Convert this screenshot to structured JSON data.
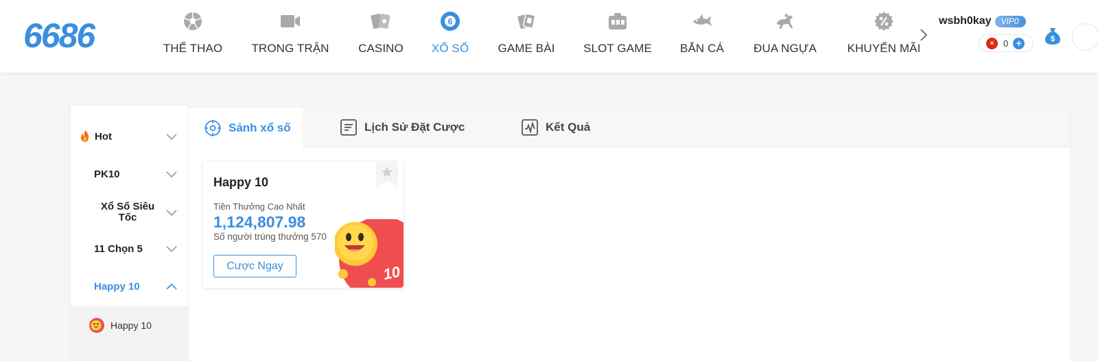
{
  "header": {
    "logo": "6686",
    "nav": [
      {
        "label": "THỂ THAO",
        "icon": "soccer-ball-icon"
      },
      {
        "label": "TRONG TRẬN",
        "icon": "video-camera-icon"
      },
      {
        "label": "CASINO",
        "icon": "playing-cards-icon"
      },
      {
        "label": "XỔ SỐ",
        "icon": "lottery-ball-icon",
        "active": true
      },
      {
        "label": "GAME BÀI",
        "icon": "card-game-icon"
      },
      {
        "label": "SLOT GAME",
        "icon": "slot-machine-icon"
      },
      {
        "label": "BẮN CÁ",
        "icon": "fish-icon"
      },
      {
        "label": "ĐUA NGỰA",
        "icon": "horse-racing-icon"
      },
      {
        "label": "KHUYẾN MÃI",
        "icon": "discount-icon"
      }
    ],
    "user": {
      "name": "wsbh0kay",
      "vip": "VIP0",
      "balance": "0",
      "currency_flag": "vietnam-flag-icon"
    }
  },
  "sidebar": {
    "items": [
      {
        "label": "Hot",
        "icon": "fire-icon"
      },
      {
        "label": "PK10"
      },
      {
        "label": "Xổ Số Siêu Tốc"
      },
      {
        "label": "11 Chọn 5"
      },
      {
        "label": "Happy 10",
        "active": true
      }
    ],
    "sub_items": [
      {
        "label": "Happy 10",
        "icon": "happy-10-icon"
      }
    ]
  },
  "tabs": [
    {
      "label": "Sảnh xổ số",
      "icon": "target-icon",
      "active": true
    },
    {
      "label": "Lịch Sử Đặt Cược",
      "icon": "document-icon"
    },
    {
      "label": "Kết Quả",
      "icon": "chart-icon"
    }
  ],
  "card": {
    "title": "Happy 10",
    "caption": "Tiền Thưởng Cao Nhất",
    "amount": "1,124,807.98",
    "winners": "Số người trúng thưởng 570",
    "bet_button": "Cược Ngay",
    "mascot_badge": "10"
  },
  "colors": {
    "accent": "#3a8fde",
    "text": "#333333",
    "background": "#f6f6f6"
  }
}
